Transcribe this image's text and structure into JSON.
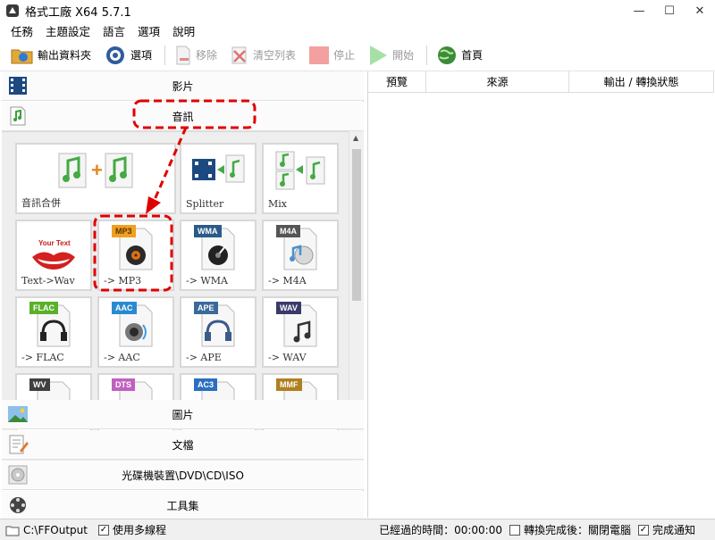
{
  "window": {
    "title": "格式工廠 X64 5.7.1",
    "min": "—",
    "max": "☐",
    "close": "✕"
  },
  "menu": [
    "任務",
    "主題設定",
    "語言",
    "選項",
    "說明"
  ],
  "toolbar": {
    "output_folder": "輸出資料夾",
    "options": "選項",
    "remove": "移除",
    "clear_list": "清空列表",
    "stop": "停止",
    "start": "開始",
    "home": "首頁"
  },
  "categories": {
    "video": "影片",
    "audio": "音訊",
    "picture": "圖片",
    "document": "文檔",
    "rom": "光碟機裝置\\DVD\\CD\\ISO",
    "tools": "工具集"
  },
  "tiles": [
    {
      "label": "音訊合併",
      "badge": ""
    },
    {
      "label": "Splitter",
      "badge": ""
    },
    {
      "label": "Mix",
      "badge": ""
    },
    {
      "label": "Text->Wav",
      "badge": "Your Text"
    },
    {
      "label": "-> MP3",
      "badge": "MP3"
    },
    {
      "label": "-> WMA",
      "badge": "WMA"
    },
    {
      "label": "-> M4A",
      "badge": "M4A"
    },
    {
      "label": "-> FLAC",
      "badge": "FLAC"
    },
    {
      "label": "-> AAC",
      "badge": "AAC"
    },
    {
      "label": "-> APE",
      "badge": "APE"
    },
    {
      "label": "-> WAV",
      "badge": "WAV"
    },
    {
      "label": "",
      "badge": "WV"
    },
    {
      "label": "",
      "badge": "DTS"
    },
    {
      "label": "",
      "badge": "AC3"
    },
    {
      "label": "",
      "badge": "MMF"
    }
  ],
  "columns": [
    "預覽",
    "來源",
    "輸出 / 轉換狀態"
  ],
  "status": {
    "output_path": "C:\\FFOutput",
    "multithread": "使用多線程",
    "elapsed": "已經過的時間：00:00:00",
    "after_convert": "轉換完成後：關閉電腦",
    "notify": "完成通知"
  },
  "colors": {
    "annotation_red": "#e00000",
    "mp3_badge": "#f0a020",
    "wma_badge": "#2a5a8a",
    "m4a_badge": "#555555",
    "flac_badge": "#5ab02a",
    "aac_badge": "#2a8ad0",
    "ape_badge": "#3a6a9a",
    "wav_badge": "#3a3a6a",
    "wv_badge": "#404040",
    "dts_badge": "#c060c0",
    "ac3_badge": "#2a70c0",
    "mmf_badge": "#b08020"
  }
}
